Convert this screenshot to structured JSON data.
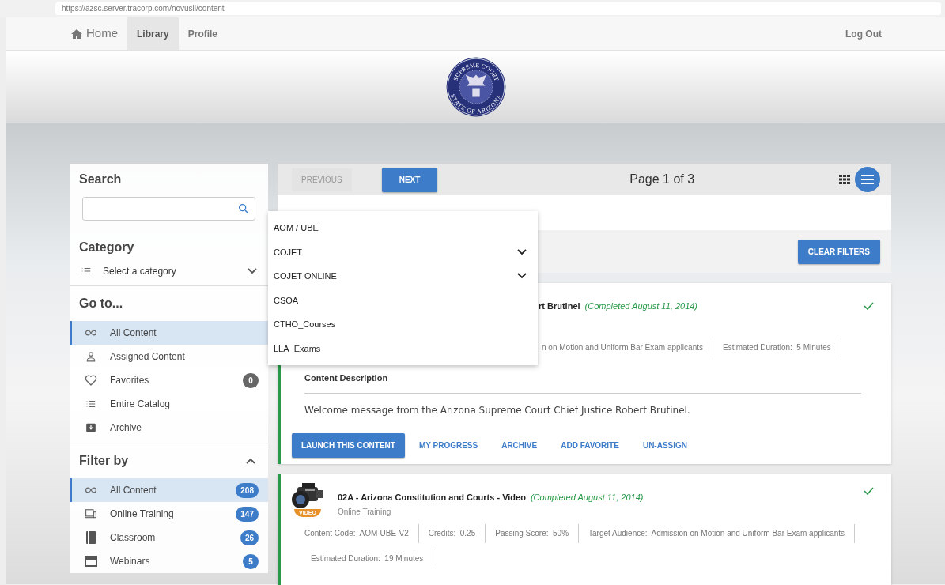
{
  "browser": {
    "url": "https://azsc.server.tracorp.com/novusll/content"
  },
  "nav": {
    "home": "Home",
    "links": [
      {
        "label": "Library",
        "selected": true
      },
      {
        "label": "Profile",
        "selected": false
      }
    ],
    "logout": "Log Out"
  },
  "seal": {
    "top_text": "SUPREME COURT",
    "bottom_text": "STATE OF ARIZONA"
  },
  "sidebar": {
    "search": {
      "title": "Search"
    },
    "category": {
      "title": "Category",
      "select": "Select a category"
    },
    "goto": {
      "title": "Go to...",
      "items": [
        {
          "label": "All Content",
          "selected": true
        },
        {
          "label": "Assigned Content",
          "selected": false
        },
        {
          "label": "Favorites",
          "count": "0",
          "selected": false
        },
        {
          "label": "Entire Catalog",
          "selected": false
        },
        {
          "label": "Archive",
          "selected": false
        }
      ]
    },
    "filter": {
      "title": "Filter by",
      "expanded": true,
      "items": [
        {
          "label": "All Content",
          "count": "208",
          "selected": true
        },
        {
          "label": "Online Training",
          "count": "147",
          "selected": false
        },
        {
          "label": "Classroom",
          "count": "26",
          "selected": false
        },
        {
          "label": "Webinars",
          "count": "5",
          "selected": false
        }
      ]
    }
  },
  "toolbar": {
    "previous": "PREVIOUS",
    "next": "NEXT",
    "page": "Page 1 of 3",
    "views": [
      {
        "selected": false
      },
      {
        "selected": true
      }
    ]
  },
  "results": {
    "clear": "CLEAR FILTERS"
  },
  "dropdown": {
    "items": [
      {
        "label": "AOM / UBE",
        "kind": "leaf"
      },
      {
        "label": "COJET",
        "kind": "group"
      },
      {
        "label": "COJET ONLINE",
        "kind": "group"
      },
      {
        "label": "CSOA",
        "kind": "leaf"
      },
      {
        "label": "CTHO_Courses",
        "kind": "leaf"
      },
      {
        "label": "LLA_Exams",
        "kind": "leaf"
      }
    ]
  },
  "items": [
    {
      "title": "rt Brutinel",
      "status": "(Completed August 11, 2014)",
      "completed": true,
      "expanded": true,
      "covered": true,
      "meta": [
        "n on Motion and Uniform Bar Exam applicants",
        "Estimated Duration:  5 Minutes"
      ],
      "description_title": "Content Description",
      "description": "Welcome message from the Arizona Supreme Court Chief Justice Robert Brutinel.",
      "actions": [
        {
          "label": "LAUNCH THIS CONTENT",
          "kind": "primary"
        },
        {
          "label": "MY PROGRESS",
          "kind": "link"
        },
        {
          "label": "ARCHIVE",
          "kind": "link"
        },
        {
          "label": "ADD FAVORITE",
          "kind": "link"
        },
        {
          "label": "UN-ASSIGN",
          "kind": "link"
        }
      ]
    },
    {
      "title": "02A - Arizona Constitution and Courts - Video",
      "status": "(Completed August 11, 2014)",
      "type": "Online Training",
      "completed": true,
      "expanded": false,
      "covered": false,
      "thumb_label": "VIDEO",
      "meta": [
        "Content Code:  AOM-UBE-V2",
        "Credits:  0.25",
        "Passing Score:  50%",
        "Target Audience:  Admission on Motion and Uniform Bar Exam applicants",
        "Estimated Duration:  19 Minutes"
      ]
    }
  ]
}
